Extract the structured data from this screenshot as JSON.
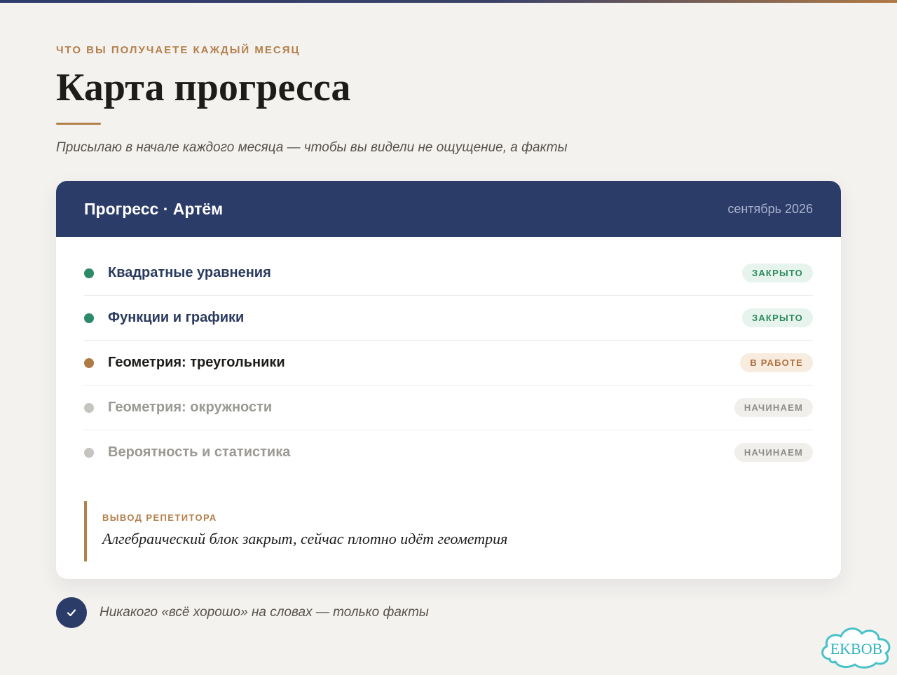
{
  "header": {
    "eyebrow": "ЧТО ВЫ ПОЛУЧАЕТЕ КАЖДЫЙ МЕСЯЦ",
    "title": "Карта прогресса",
    "subtitle": "Присылаю в начале каждого месяца — чтобы вы видели не ощущение, а факты"
  },
  "card": {
    "title": "Прогресс · Артём",
    "date": "сентябрь 2026",
    "topics": [
      {
        "label": "Квадратные уравнения",
        "status": "ЗАКРЫТО"
      },
      {
        "label": "Функции и графики",
        "status": "ЗАКРЫТО"
      },
      {
        "label": "Геометрия: треугольники",
        "status": "В РАБОТЕ"
      },
      {
        "label": "Геометрия: окружности",
        "status": "НАЧИНАЕМ"
      },
      {
        "label": "Вероятность и статистика",
        "status": "НАЧИНАЕМ"
      }
    ],
    "conclusion": {
      "label": "ВЫВОД РЕПЕТИТОРА",
      "text": "Алгебраический блок закрыт, сейчас плотно идёт геометрия"
    }
  },
  "footer": {
    "text": "Никакого «всё хорошо» на словах — только факты",
    "icon": "check-icon"
  },
  "watermark": {
    "text": "EKBOB",
    "icon": "cloud-logo-icon"
  },
  "colors": {
    "accent": "#b3804b",
    "navy": "#2c3c69",
    "status_closed": "#2d8a66",
    "status_in_progress": "#b07a45",
    "status_starting": "#c6c4c0"
  }
}
